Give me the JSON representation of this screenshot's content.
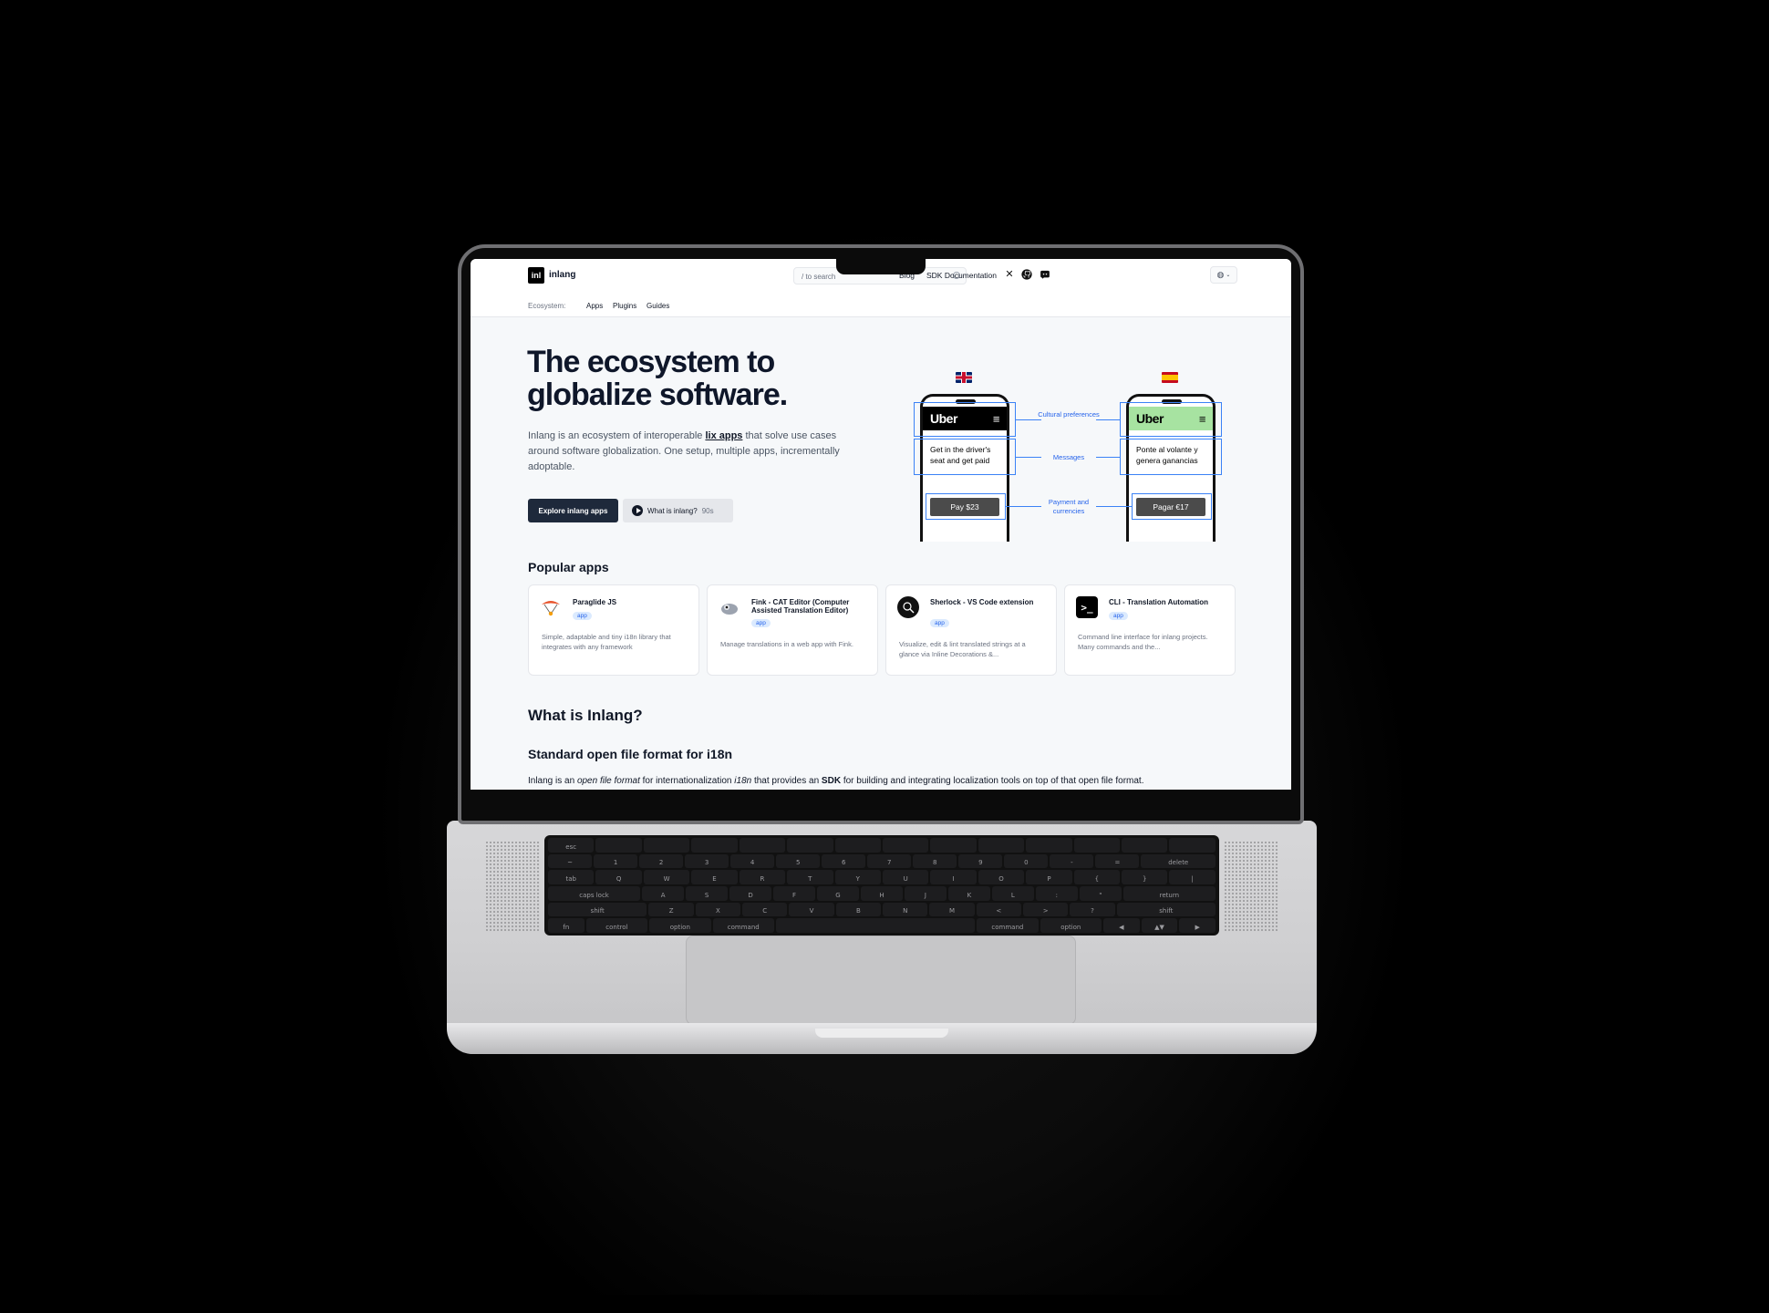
{
  "site": {
    "logo_mark": "inl",
    "logo_text": "inlang",
    "search_placeholder": "/ to search",
    "nav": {
      "blog": "Blog",
      "sdk_docs": "SDK Documentation"
    },
    "social_icons": [
      "x-icon",
      "github-icon",
      "discord-icon"
    ],
    "lang_icon": "globe-icon",
    "ecosystem": {
      "label": "Ecosystem:",
      "links": [
        "Apps",
        "Plugins",
        "Guides"
      ]
    },
    "hero": {
      "title": "The ecosystem to globalize software.",
      "desc_before": "Inlang is an ecosystem of interoperable",
      "desc_link": "lix apps",
      "desc_after": "that solve use cases around software globalization. One setup, multiple apps, incrementally adoptable.",
      "primary_button": "Explore inlang apps",
      "secondary_button": "What is inlang?",
      "secondary_duration": "90s"
    },
    "illustration": {
      "en": {
        "brand": "Uber",
        "message": "Get in the driver's seat and get paid",
        "pay": "Pay $23"
      },
      "es": {
        "brand": "Uber",
        "message": "Ponte al volante y genera ganancias",
        "pay": "Pagar €17"
      },
      "callouts": [
        "Cultural preferences",
        "Messages",
        "Payment and currencies"
      ],
      "colors": {
        "en_header": "#000000",
        "es_header": "#a7e3a1",
        "highlight": "#3b82f6"
      }
    },
    "popular_apps": {
      "heading": "Popular apps",
      "cards": [
        {
          "title": "Paraglide JS",
          "badge": "app",
          "desc": "Simple, adaptable and tiny i18n library that integrates with any framework",
          "icon": "paraglider-icon"
        },
        {
          "title": "Fink - CAT Editor (Computer Assisted Translation Editor)",
          "badge": "app",
          "desc": "Manage translations in a web app with Fink.",
          "icon": "fink-bird-icon"
        },
        {
          "title": "Sherlock - VS Code extension",
          "badge": "app",
          "desc": "Visualize, edit & lint translated strings at a glance via Inline Decorations &...",
          "icon": "sherlock-icon"
        },
        {
          "title": "CLI - Translation Automation",
          "badge": "app",
          "desc": "Command line interface for inlang projects. Many commands and the...",
          "icon": "terminal-icon"
        }
      ]
    },
    "what_is": {
      "heading": "What is Inlang?",
      "subheading": "Standard open file format for i18n",
      "p1": "Inlang is an",
      "p_em1": "open file format",
      "p2": "for internationalization",
      "p_em2": "i18n",
      "p3": "that provides an",
      "p_b": "SDK",
      "p4": "for building and integrating localization tools on top of that open file format."
    }
  },
  "keyboard": {
    "rows": [
      [
        "esc",
        "",
        "",
        "",
        "",
        "",
        "",
        "",
        "",
        "",
        "",
        "",
        "",
        ""
      ],
      [
        "~",
        "1",
        "2",
        "3",
        "4",
        "5",
        "6",
        "7",
        "8",
        "9",
        "0",
        "-",
        "=",
        "delete"
      ],
      [
        "tab",
        "Q",
        "W",
        "E",
        "R",
        "T",
        "Y",
        "U",
        "I",
        "O",
        "P",
        "{",
        "}",
        "|"
      ],
      [
        "caps lock",
        "A",
        "S",
        "D",
        "F",
        "G",
        "H",
        "J",
        "K",
        "L",
        ":",
        "\"",
        "return"
      ],
      [
        "shift",
        "Z",
        "X",
        "C",
        "V",
        "B",
        "N",
        "M",
        "<",
        ">",
        "?",
        "shift"
      ],
      [
        "fn",
        "control",
        "option",
        "command",
        "",
        "command",
        "option",
        "◀",
        "▲▼",
        "▶"
      ]
    ]
  }
}
